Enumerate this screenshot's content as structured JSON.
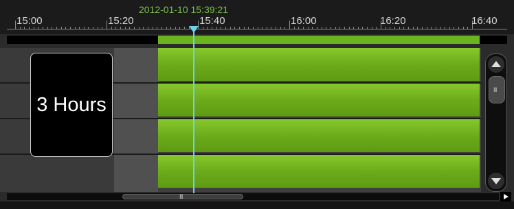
{
  "timeline": {
    "current_time": "2012-01-10 15:39:21",
    "ruler_labels": [
      "15:00",
      "15:20",
      "15:40",
      "16:00",
      "16:20",
      "16:40"
    ],
    "zoom_label": "3 Hours"
  },
  "colors": {
    "recording": "#69b41f",
    "playhead": "#6fd2ea",
    "current_time_text": "#79c34a"
  },
  "icons": {
    "scroll_up": "triangle-up",
    "scroll_down": "triangle-down",
    "scroll_right": "triangle-right",
    "grip": "vertical-bars"
  },
  "scrollbars": {
    "grip_text": "III"
  }
}
